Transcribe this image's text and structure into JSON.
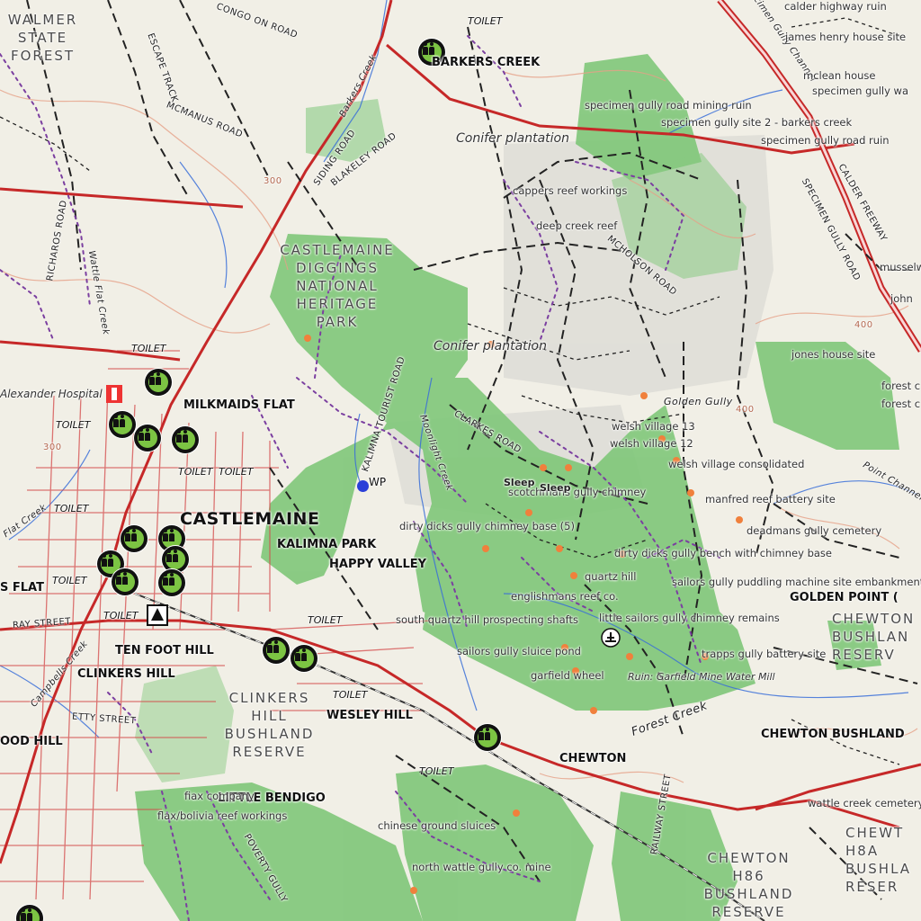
{
  "map": {
    "toilet_label": "TOILET",
    "towns": [
      "BARKERS CREEK",
      "MILKMAIDS FLAT",
      "CASTLEMAINE",
      "KALIMNA PARK",
      "HAPPY VALLEY",
      "TEN FOOT HILL",
      "CLINKERS HILL",
      "WESLEY HILL",
      "CHEWTON",
      "LITTLE BENDIGO",
      "GOLDEN POINT (",
      "CHEWTON BUSHLAND",
      "OOD HILL",
      "S FLAT"
    ],
    "areas": {
      "walmer": [
        "WALMER",
        "STATE",
        "FOREST"
      ],
      "diggings": [
        "CASTLEMAINE",
        "DIGGINGS",
        "NATIONAL",
        "HERITAGE",
        "PARK"
      ],
      "clinkers_reserve": [
        "CLINKERS",
        "HILL",
        "BUSHLAND",
        "RESERVE"
      ],
      "chewton_h86": [
        "CHEWTON",
        "H86",
        "BUSHLAND",
        "RESERVE"
      ],
      "chewton_right": [
        "CHEWTON",
        "BUSHLAN",
        "RESERV"
      ],
      "chewton_h8a": [
        "CHEWT",
        "H8A",
        "BUSHLA",
        "RESER"
      ]
    },
    "plantations": [
      "Conifer plantation",
      "Conifer plantation"
    ],
    "roads": [
      "CONGO ON ROAD",
      "ESCAPE TRACK",
      "MCMANUS ROAD",
      "SIDING ROAD",
      "BLAKELEY ROAD",
      "Barkers Creek",
      "RICHAROS ROAD",
      "Wattle Flat Creek",
      "CLARKES ROAD",
      "KALIMNA TOURIST ROAD",
      "Moonlight Creek",
      "MCHOLSON ROAD",
      "SPECIMEN GULLY ROAD",
      "CALDER FREEWAY",
      "RAY STREET",
      "ETTY STREET",
      "POVERTY GULLY",
      "RAILWAY STREET",
      "Forest Creek",
      "Golden Gully",
      "Point Channel",
      "Specimen Gully Channel",
      "Flat Creek",
      "Campbells Creek"
    ],
    "sites": [
      "calder highway ruin",
      "james henry house site",
      "mclean house",
      "specimen gully wa",
      "specimen gully road mining ruin",
      "specimen gully site 2 - barkers creek",
      "specimen gully road ruin",
      "cappers reef workings",
      "deep creek reef",
      "musselw",
      "john",
      "jones house site",
      "forest c",
      "forest c",
      "welsh village 13",
      "welsh village 12",
      "welsh village consolidated",
      "manfred reef battery site",
      "deadmans gully cemetery",
      "dirty dicks gully chimney base (5)",
      "dirty dicks gully bench with chimney base",
      "quartz hill",
      "sailors gully puddling machine site embankment",
      "englishmans reef co.",
      "south quartz hill prospecting shafts",
      "little sailors gully chimney remains",
      "sailors gully sluice pond",
      "garfield wheel",
      "trapps gully battery site",
      "Ruin: Garfield Mine Water Mill",
      "scotchmans gully chimney",
      "wattle creek cemetery",
      "chinese ground sluices",
      "north wattle gully co. mine",
      "fiax company",
      "flax/bolivia reef workings",
      "Alexander Hospital"
    ],
    "sleep_labels": [
      "Sleep",
      "Sleep"
    ],
    "waypoint_label": "WP",
    "hospital_label": "Alexander Hospital",
    "contour_labels": [
      "300",
      "300",
      "400",
      "400"
    ],
    "colors": {
      "forest": "#7cc676",
      "road": "#c62828",
      "track": "#222222",
      "walk": "#7b3fa0",
      "water": "#3a6fd8",
      "poi_green": "#7cc443"
    }
  }
}
